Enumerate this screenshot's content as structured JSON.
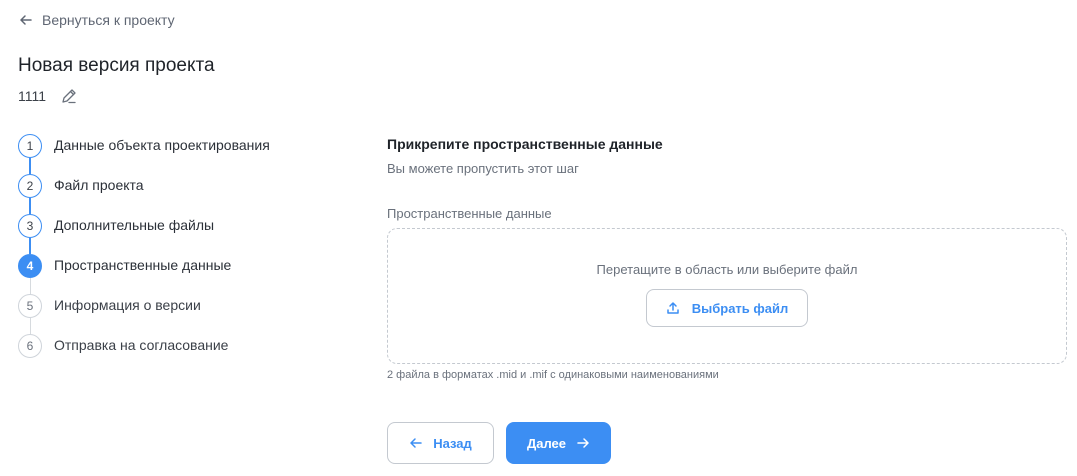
{
  "nav": {
    "back_label": "Вернуться к проекту"
  },
  "header": {
    "title": "Новая версия проекта",
    "project_name": "1111"
  },
  "steps": [
    {
      "number": "1",
      "label": "Данные объекта проектирования",
      "state": "done"
    },
    {
      "number": "2",
      "label": "Файл проекта",
      "state": "done"
    },
    {
      "number": "3",
      "label": "Дополнительные файлы",
      "state": "done"
    },
    {
      "number": "4",
      "label": "Пространственные данные",
      "state": "active"
    },
    {
      "number": "5",
      "label": "Информация о версии",
      "state": "future"
    },
    {
      "number": "6",
      "label": "Отправка на согласование",
      "state": "future"
    }
  ],
  "content": {
    "title": "Прикрепите пространственные данные",
    "subtitle": "Вы можете пропустить этот шаг",
    "field_label": "Пространственные данные",
    "dropzone_text": "Перетащите в область или выберите файл",
    "choose_file_label": "Выбрать файл",
    "hint": "2 файла в форматах .mid и .mif с одинаковыми наименованиями"
  },
  "footer": {
    "back_label": "Назад",
    "next_label": "Далее"
  },
  "colors": {
    "accent": "#3c8ef3",
    "muted": "#6a717c",
    "border": "#c4c9d0"
  },
  "icons": {
    "back_link": "arrow-left-icon",
    "edit": "pencil-icon",
    "upload": "upload-icon",
    "back_button": "arrow-left-icon",
    "next_button": "arrow-right-icon"
  }
}
